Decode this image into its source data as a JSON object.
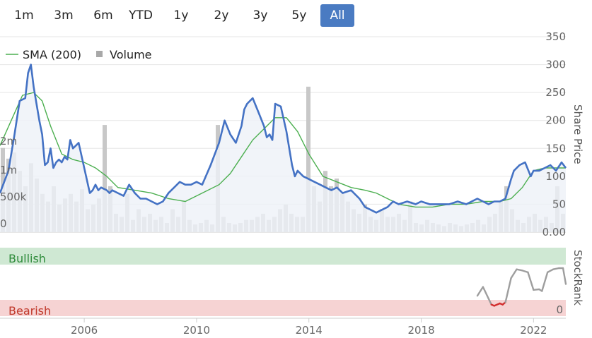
{
  "range_buttons": [
    {
      "label": "1m",
      "active": false
    },
    {
      "label": "3m",
      "active": false
    },
    {
      "label": "6m",
      "active": false
    },
    {
      "label": "YTD",
      "active": false
    },
    {
      "label": "1y",
      "active": false
    },
    {
      "label": "2y",
      "active": false
    },
    {
      "label": "3y",
      "active": false
    },
    {
      "label": "5y",
      "active": false
    },
    {
      "label": "All",
      "active": true
    }
  ],
  "colors": {
    "price": "#4472c4",
    "sma": "#4caf50",
    "volume": "#c8c8c8",
    "area": "#eef1f8",
    "bullish": "#cfe8d3",
    "bearish": "#f6d3d3",
    "bullish_text": "#2e8b3a",
    "bearish_text": "#c0392b",
    "rank_line": "#9e9e9e",
    "rank_low": "#d32f2f",
    "active_btn": "#4a7bc2"
  },
  "chart_data": [
    {
      "type": "line",
      "legend": [
        {
          "name": "SMA (200)",
          "icon": "line"
        },
        {
          "name": "Volume",
          "icon": "square"
        }
      ],
      "ylabel_right": "Share Price",
      "price_ticks": [
        "350",
        "300",
        "250",
        "200",
        "150",
        "100",
        "50",
        "0.00"
      ],
      "price_ylim": [
        0,
        350
      ],
      "volume_ticks": [
        "2m",
        "1m",
        "500k",
        "0"
      ],
      "x_ticks": [
        "2006",
        "2010",
        "2014",
        "2018",
        "2022"
      ],
      "xlim": [
        2003.0,
        2023.15
      ],
      "price_series": {
        "name": "Share Price",
        "x": [
          2003.0,
          2003.3,
          2003.5,
          2003.7,
          2003.9,
          2004.0,
          2004.1,
          2004.2,
          2004.3,
          2004.4,
          2004.5,
          2004.6,
          2004.7,
          2004.8,
          2004.9,
          2005.0,
          2005.1,
          2005.2,
          2005.3,
          2005.4,
          2005.5,
          2005.6,
          2005.8,
          2006.0,
          2006.2,
          2006.3,
          2006.4,
          2006.5,
          2006.6,
          2006.8,
          2006.9,
          2007.0,
          2007.2,
          2007.4,
          2007.6,
          2007.8,
          2008.0,
          2008.2,
          2008.4,
          2008.6,
          2008.8,
          2009.0,
          2009.2,
          2009.4,
          2009.6,
          2009.8,
          2010.0,
          2010.2,
          2010.5,
          2010.8,
          2011.0,
          2011.2,
          2011.4,
          2011.6,
          2011.7,
          2011.8,
          2012.0,
          2012.2,
          2012.4,
          2012.5,
          2012.6,
          2012.7,
          2012.8,
          2013.0,
          2013.2,
          2013.4,
          2013.5,
          2013.6,
          2013.8,
          2014.0,
          2014.2,
          2014.4,
          2014.6,
          2014.8,
          2015.0,
          2015.2,
          2015.5,
          2015.8,
          2016.0,
          2016.2,
          2016.4,
          2016.6,
          2016.8,
          2017.0,
          2017.2,
          2017.5,
          2017.8,
          2018.0,
          2018.3,
          2018.6,
          2019.0,
          2019.3,
          2019.6,
          2020.0,
          2020.2,
          2020.4,
          2020.6,
          2020.8,
          2021.0,
          2021.2,
          2021.3,
          2021.5,
          2021.7,
          2021.9,
          2022.0,
          2022.2,
          2022.4,
          2022.6,
          2022.8,
          2023.0,
          2023.15
        ],
        "y": [
          70,
          110,
          170,
          235,
          240,
          285,
          300,
          260,
          230,
          200,
          175,
          120,
          125,
          150,
          115,
          125,
          130,
          125,
          135,
          130,
          165,
          150,
          160,
          115,
          70,
          75,
          85,
          75,
          80,
          75,
          70,
          75,
          70,
          65,
          85,
          70,
          60,
          60,
          55,
          50,
          55,
          70,
          80,
          90,
          85,
          85,
          90,
          85,
          120,
          160,
          200,
          175,
          160,
          190,
          220,
          230,
          240,
          215,
          190,
          170,
          175,
          165,
          230,
          225,
          180,
          120,
          100,
          110,
          100,
          95,
          90,
          85,
          80,
          75,
          80,
          70,
          75,
          60,
          45,
          40,
          35,
          40,
          45,
          55,
          50,
          55,
          50,
          55,
          50,
          50,
          50,
          55,
          50,
          60,
          55,
          50,
          55,
          55,
          60,
          95,
          110,
          120,
          125,
          100,
          110,
          110,
          115,
          120,
          110,
          125,
          115,
          130,
          130
        ]
      },
      "sma_series": {
        "name": "SMA (200)",
        "x": [
          2003.0,
          2003.4,
          2003.8,
          2004.2,
          2004.5,
          2004.8,
          2005.2,
          2005.6,
          2006.0,
          2006.4,
          2006.8,
          2007.2,
          2007.8,
          2008.4,
          2009.0,
          2009.6,
          2010.2,
          2010.8,
          2011.2,
          2011.6,
          2012.0,
          2012.4,
          2012.8,
          2013.2,
          2013.6,
          2014.0,
          2014.5,
          2015.0,
          2015.5,
          2016.0,
          2016.4,
          2016.8,
          2017.2,
          2017.8,
          2018.4,
          2019.0,
          2019.6,
          2020.2,
          2020.8,
          2021.2,
          2021.6,
          2022.0,
          2022.4,
          2022.8,
          2023.15
        ],
        "y": [
          155,
          200,
          245,
          250,
          235,
          190,
          140,
          130,
          125,
          115,
          100,
          80,
          75,
          70,
          60,
          55,
          70,
          85,
          105,
          135,
          165,
          185,
          205,
          205,
          180,
          140,
          100,
          90,
          80,
          75,
          70,
          60,
          50,
          45,
          45,
          50,
          50,
          55,
          55,
          60,
          80,
          110,
          115,
          115,
          115
        ]
      },
      "volume_bars": [
        0.55,
        0.48,
        0.52,
        0.4,
        0.3,
        0.45,
        0.35,
        0.25,
        0.2,
        0.3,
        0.18,
        0.22,
        0.25,
        0.2,
        0.28,
        0.15,
        0.18,
        0.22,
        0.7,
        0.3,
        0.12,
        0.1,
        0.25,
        0.08,
        0.15,
        0.1,
        0.12,
        0.08,
        0.1,
        0.06,
        0.15,
        0.1,
        0.2,
        0.08,
        0.05,
        0.06,
        0.08,
        0.05,
        0.7,
        0.1,
        0.06,
        0.05,
        0.06,
        0.08,
        0.08,
        0.1,
        0.12,
        0.08,
        0.1,
        0.15,
        0.18,
        0.12,
        0.1,
        0.1,
        0.95,
        0.3,
        0.2,
        0.4,
        0.3,
        0.35,
        0.25,
        0.2,
        0.15,
        0.12,
        0.18,
        0.1,
        0.08,
        0.15,
        0.1,
        0.1,
        0.12,
        0.08,
        0.2,
        0.06,
        0.05,
        0.08,
        0.06,
        0.05,
        0.04,
        0.06,
        0.05,
        0.04,
        0.05,
        0.06,
        0.08,
        0.05,
        0.1,
        0.12,
        0.2,
        0.3,
        0.15,
        0.08,
        0.06,
        0.1,
        0.12,
        0.08,
        0.1,
        0.06,
        0.3,
        0.12
      ],
      "stockrank": {
        "ylabel": "StockRank",
        "zero_label": "0",
        "bands": [
          {
            "label": "Bullish"
          },
          {
            "label": "Bearish"
          }
        ],
        "x": [
          2020.0,
          2020.2,
          2020.4,
          2020.5,
          2020.6,
          2020.8,
          2020.9,
          2021.0,
          2021.2,
          2021.4,
          2021.6,
          2021.8,
          2022.0,
          2022.2,
          2022.3,
          2022.5,
          2022.7,
          2022.9,
          2023.05,
          2023.15
        ],
        "y": [
          25,
          40,
          20,
          10,
          8,
          12,
          10,
          14,
          55,
          70,
          68,
          65,
          35,
          36,
          33,
          65,
          70,
          72,
          72,
          45
        ]
      }
    }
  ]
}
